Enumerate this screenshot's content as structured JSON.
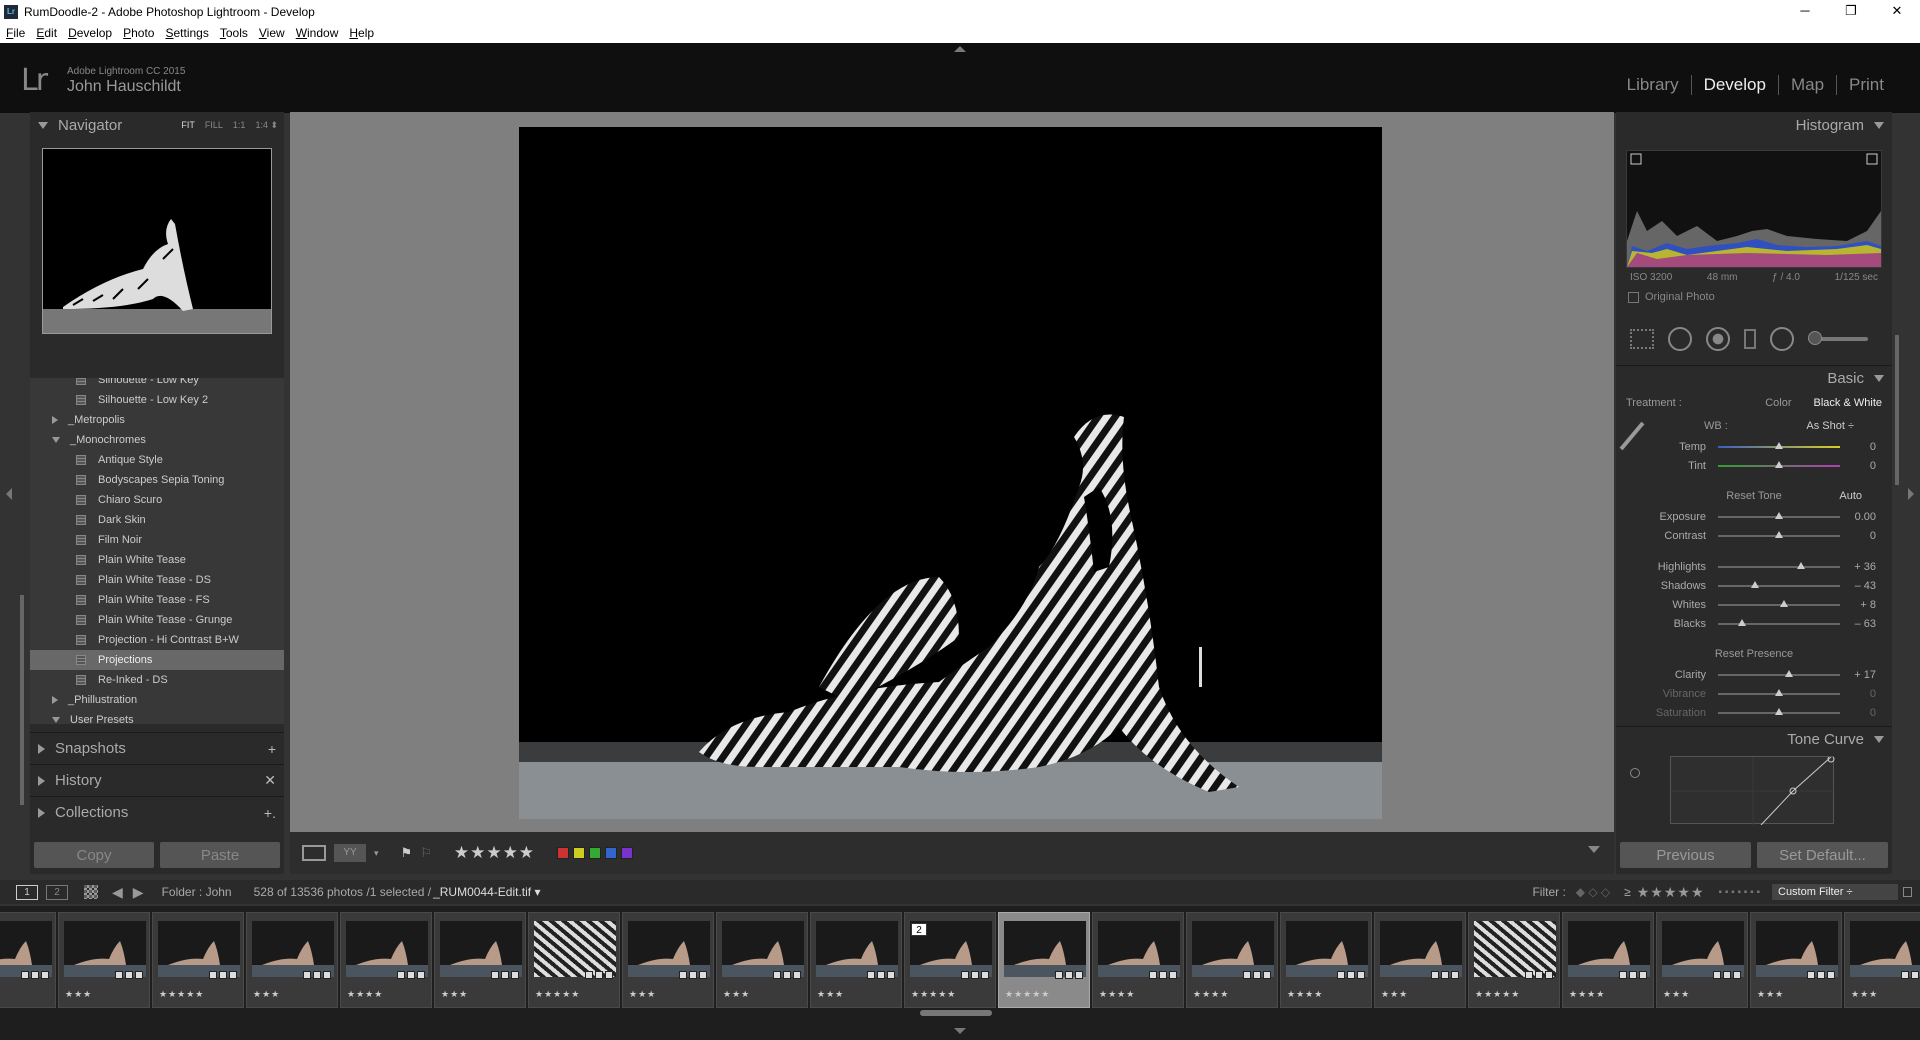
{
  "window": {
    "title": "RumDoodle-2 - Adobe Photoshop Lightroom - Develop",
    "icon": "lightroom-app-icon",
    "controls": [
      "─",
      "❐",
      "✕"
    ]
  },
  "menu": [
    "File",
    "Edit",
    "Develop",
    "Photo",
    "Settings",
    "Tools",
    "View",
    "Window",
    "Help"
  ],
  "identity": {
    "logo": "Lr",
    "product": "Adobe Lightroom CC 2015",
    "user": "John Hauschildt"
  },
  "modules": {
    "library": "Library",
    "develop": "Develop",
    "map": "Map",
    "print": "Print",
    "active": "Develop"
  },
  "navigator": {
    "title": "Navigator",
    "zoom": [
      "FIT",
      "FILL",
      "1:1",
      "1:4 ⬍"
    ]
  },
  "presets": {
    "rows": [
      {
        "label": "Silhouette - Low Key",
        "type": "preset",
        "cut": true
      },
      {
        "label": "Silhouette - Low Key 2",
        "type": "preset"
      },
      {
        "label": "_Metropolis",
        "type": "folder-closed"
      },
      {
        "label": "_Monochromes",
        "type": "folder-open"
      },
      {
        "label": "Antique Style",
        "type": "preset"
      },
      {
        "label": "Bodyscapes Sepia Toning",
        "type": "preset"
      },
      {
        "label": "Chiaro Scuro",
        "type": "preset"
      },
      {
        "label": "Dark Skin",
        "type": "preset"
      },
      {
        "label": "Film Noir",
        "type": "preset"
      },
      {
        "label": "Plain White Tease",
        "type": "preset"
      },
      {
        "label": "Plain White Tease - DS",
        "type": "preset"
      },
      {
        "label": "Plain White Tease - FS",
        "type": "preset"
      },
      {
        "label": "Plain White Tease - Grunge",
        "type": "preset"
      },
      {
        "label": "Projection - Hi Contrast B+W",
        "type": "preset"
      },
      {
        "label": "Projections",
        "type": "preset",
        "selected": true
      },
      {
        "label": "Re-Inked - DS",
        "type": "preset"
      },
      {
        "label": "_Phillustration",
        "type": "folder-closed"
      },
      {
        "label": "User Presets",
        "type": "folder-open"
      }
    ]
  },
  "left_sections": [
    {
      "label": "Snapshots",
      "action": "+"
    },
    {
      "label": "History",
      "action": "✕"
    },
    {
      "label": "Collections",
      "action": "+."
    }
  ],
  "left_buttons": {
    "copy": "Copy",
    "paste": "Paste"
  },
  "toolbar": {
    "stars": "★★★★★",
    "color_labels": [
      "#cc3333",
      "#cccc22",
      "#33aa33",
      "#3366cc",
      "#7733cc"
    ]
  },
  "histogram": {
    "title": "Histogram",
    "iso": "ISO 3200",
    "focal": "48 mm",
    "aperture": "ƒ / 4.0",
    "shutter": "1/125 sec",
    "original": "Original Photo"
  },
  "basic": {
    "title": "Basic",
    "treatment_label": "Treatment :",
    "color": "Color",
    "bw": "Black & White",
    "wb_label": "WB :",
    "wb_value": "As Shot ÷",
    "wb_sliders": [
      {
        "label": "Temp",
        "value": "0",
        "pos": 0.5
      },
      {
        "label": "Tint",
        "value": "0",
        "pos": 0.5
      }
    ],
    "reset_tone": "Reset Tone",
    "auto": "Auto",
    "tone_sliders": [
      {
        "label": "Exposure",
        "value": "0.00",
        "pos": 0.5
      },
      {
        "label": "Contrast",
        "value": "0",
        "pos": 0.5
      }
    ],
    "hl_sliders": [
      {
        "label": "Highlights",
        "value": "+ 36",
        "pos": 0.68
      },
      {
        "label": "Shadows",
        "value": "– 43",
        "pos": 0.3
      },
      {
        "label": "Whites",
        "value": "+ 8",
        "pos": 0.54
      },
      {
        "label": "Blacks",
        "value": "– 63",
        "pos": 0.2
      }
    ],
    "reset_presence": "Reset Presence",
    "presence_sliders": [
      {
        "label": "Clarity",
        "value": "+ 17",
        "pos": 0.58
      },
      {
        "label": "Vibrance",
        "value": "0",
        "pos": 0.5,
        "dim": true
      },
      {
        "label": "Saturation",
        "value": "0",
        "pos": 0.5,
        "dim": true
      }
    ]
  },
  "tone_curve": {
    "title": "Tone Curve"
  },
  "right_buttons": {
    "previous": "Previous",
    "setdefault": "Set Default..."
  },
  "filmbar": {
    "page1": "1",
    "page2": "2",
    "folder": "Folder : John",
    "count": "528 of 13536 photos /1 selected /",
    "file": "_RUM0044-Edit.tif ▾",
    "filter_label": "Filter :",
    "filter_cmp": "≥",
    "filter_stars": "★★★★★",
    "custom": "Custom Filter ÷"
  },
  "filmstrip": [
    {
      "stars": "★★★",
      "type": "pose"
    },
    {
      "stars": "★★★",
      "type": "pose"
    },
    {
      "stars": "★★★★★",
      "type": "pose"
    },
    {
      "stars": "★★★",
      "type": "pose"
    },
    {
      "stars": "★★★★",
      "type": "pose"
    },
    {
      "stars": "★★★",
      "type": "pose"
    },
    {
      "stars": "★★★★★",
      "type": "zebra"
    },
    {
      "stars": "★★★",
      "type": "pose"
    },
    {
      "stars": "★★★",
      "type": "pose"
    },
    {
      "stars": "★★★",
      "type": "pose"
    },
    {
      "stars": "★★★★★",
      "type": "pose",
      "badge": "2"
    },
    {
      "stars": "★★★★★",
      "type": "sel"
    },
    {
      "stars": "★★★★",
      "type": "pose"
    },
    {
      "stars": "★★★★",
      "type": "pose"
    },
    {
      "stars": "★★★★",
      "type": "pose"
    },
    {
      "stars": "★★★",
      "type": "pose"
    },
    {
      "stars": "★★★★★",
      "type": "zebra"
    },
    {
      "stars": "★★★★",
      "type": "pose"
    },
    {
      "stars": "★★★",
      "type": "pose"
    },
    {
      "stars": "★★★",
      "type": "pose"
    },
    {
      "stars": "★★★",
      "type": "pose"
    }
  ]
}
